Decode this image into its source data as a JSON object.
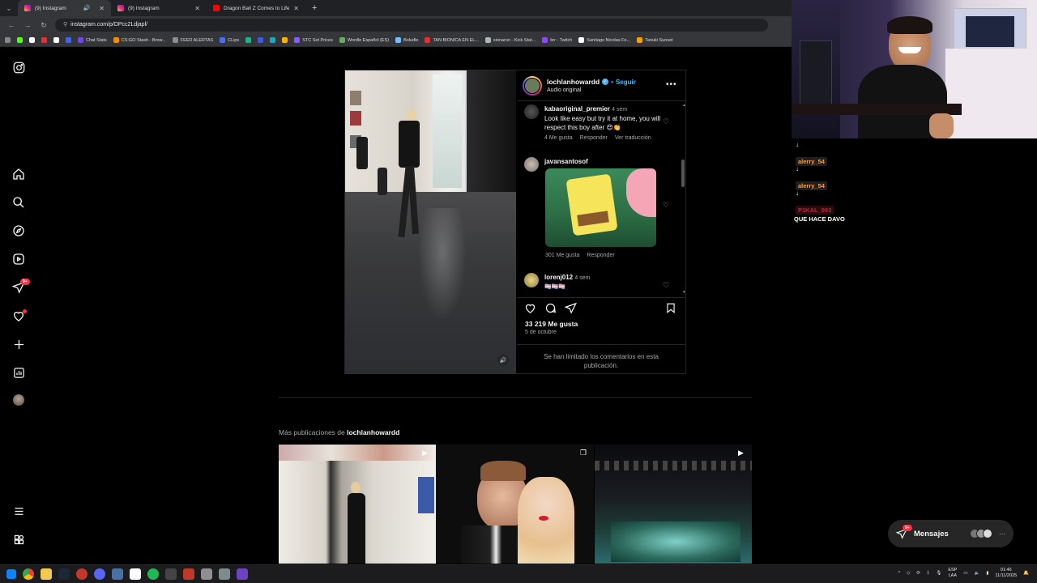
{
  "browser": {
    "tabs": [
      {
        "label": "(9) Instagram",
        "active": true
      },
      {
        "label": "(9) Instagram",
        "active": false
      },
      {
        "label": "Dragon Ball Z Comes to Life: P",
        "active": false
      }
    ],
    "url": "instagram.com/p/DPcc2Ldjapl/",
    "bookmarks": [
      "Chat Stats",
      "CS:GO Stash - Brow...",
      "FEED ALERTAS",
      "CLips",
      "STC Set Prices",
      "Wordle Español (ES)",
      "Boludle",
      "TAN BIONICA EN EL...",
      "sionaron - Kick Stat...",
      "brr - Twitch",
      "Santiago Nicolas Fe...",
      "Tanuki Sunset"
    ]
  },
  "post": {
    "username": "lochlanhowardd",
    "follow_sep": "•",
    "follow_label": "Seguir",
    "audio": "Audio original",
    "comments": [
      {
        "user": "kabaoriginal_premier",
        "time": "4 sem",
        "text": "Look like easy but try it at home, you will respect this boy after 😍👏",
        "likes": "4 Me gusta",
        "reply": "Responder",
        "translate": "Ver traducción"
      },
      {
        "user": "javansantosof",
        "time": "",
        "text": "",
        "likes": "301 Me gusta",
        "reply": "Responder",
        "translate": ""
      },
      {
        "user": "lorenj012",
        "time": "4 sem",
        "text": "🏳️‍⚧️🏳️‍⚧️🏳️‍⚧️",
        "likes": "",
        "reply": "",
        "translate": ""
      }
    ],
    "like_count": "33 219 Me gusta",
    "date": "5 de octubre",
    "limited_msg": "Se han limitado los comentarios en esta publicación."
  },
  "more": {
    "prefix": "Más publicaciones de",
    "user": "lochlanhowardd"
  },
  "nav": {
    "notif_badge": "9+"
  },
  "messages": {
    "label": "Mensajes",
    "badge": "9+"
  },
  "chat": [
    {
      "user": "alerry_54",
      "color": "#ff9b3d"
    },
    {
      "user": "alerry_54",
      "color": "#ff9b3d"
    },
    {
      "user": "P1KAL_093",
      "color": "#e0152d",
      "msg": "QUE HACE DAVO"
    }
  ],
  "tray": {
    "lang1": "ESP",
    "lang2": "LAA",
    "time": "01:46",
    "date": "11/11/2025"
  },
  "colors": {
    "accent": "#4cb5f9",
    "badge": "#ff3040"
  }
}
